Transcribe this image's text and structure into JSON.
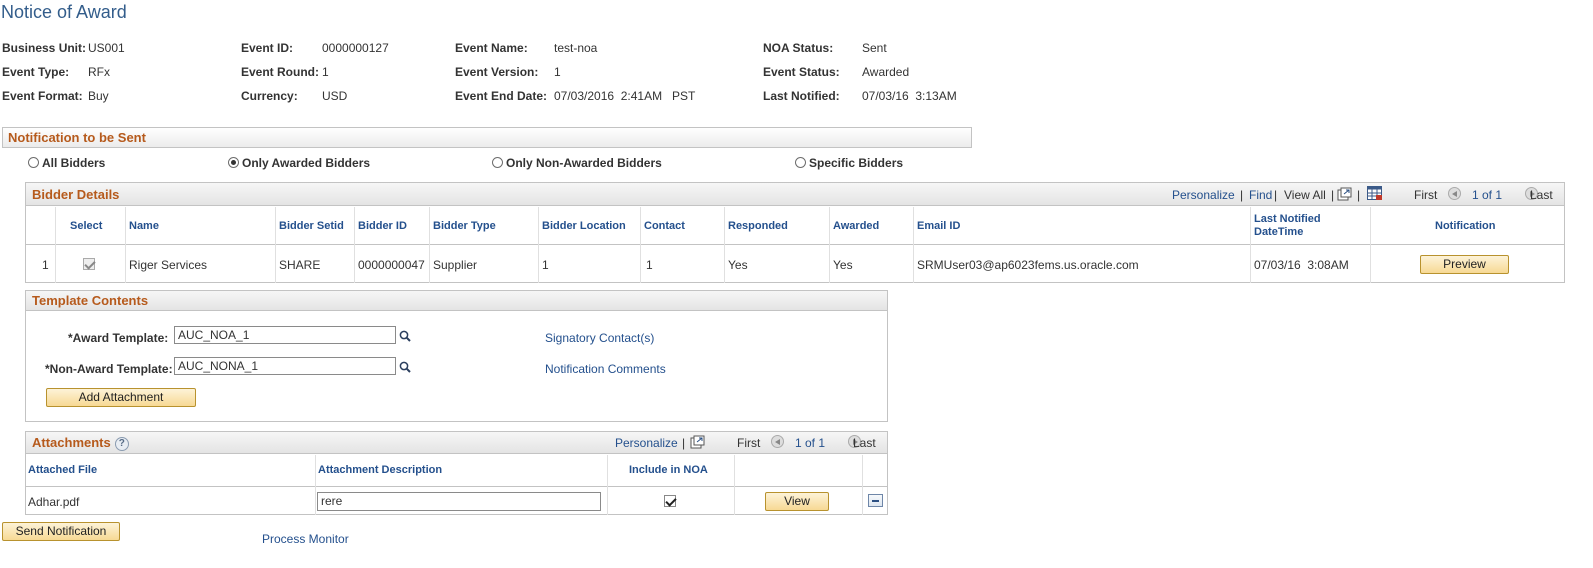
{
  "page": {
    "title": "Notice of Award"
  },
  "header": {
    "business_unit_label": "Business Unit:",
    "business_unit": "US001",
    "event_type_label": "Event Type:",
    "event_type": "RFx",
    "event_format_label": "Event Format:",
    "event_format": "Buy",
    "event_id_label": "Event ID:",
    "event_id": "0000000127",
    "event_round_label": "Event Round:",
    "event_round": "1",
    "currency_label": "Currency:",
    "currency": "USD",
    "event_name_label": "Event Name:",
    "event_name": "test-noa",
    "event_version_label": "Event Version:",
    "event_version": "1",
    "event_end_date_label": "Event End Date:",
    "event_end_date": "07/03/2016  2:41AM",
    "event_end_tz": "PST",
    "noa_status_label": "NOA Status:",
    "noa_status": "Sent",
    "event_status_label": "Event Status:",
    "event_status": "Awarded",
    "last_notified_label": "Last Notified:",
    "last_notified": "07/03/16  3:13AM"
  },
  "notification": {
    "section_title": "Notification to be Sent",
    "options": [
      "All Bidders",
      "Only Awarded Bidders",
      "Only Non-Awarded Bidders",
      "Specific Bidders"
    ],
    "selected": "Only Awarded Bidders"
  },
  "bidder_grid": {
    "title": "Bidder Details",
    "personalize": "Personalize",
    "find": "Find",
    "view_all": "View All",
    "sep": "|",
    "first": "First",
    "range": "1 of 1",
    "last": "Last",
    "columns": [
      "Select",
      "Name",
      "Bidder Setid",
      "Bidder ID",
      "Bidder Type",
      "Bidder Location",
      "Contact",
      "Responded",
      "Awarded",
      "Email ID",
      "Last Notified DateTime",
      "Notification"
    ],
    "last_notified_line1": "Last Notified",
    "last_notified_line2": "DateTime",
    "rows": [
      {
        "num": "1",
        "select": true,
        "name": "Riger Services",
        "setid": "SHARE",
        "bidder_id": "0000000047",
        "type": "Supplier",
        "location": "1",
        "contact": "1",
        "responded": "Yes",
        "awarded": "Yes",
        "email": "SRMUser03@ap6023fems.us.oracle.com",
        "last_notified": "07/03/16  3:08AM",
        "button": "Preview"
      }
    ]
  },
  "template": {
    "title": "Template Contents",
    "award_label": "*Award Template:",
    "award_value": "AUC_NOA_1",
    "nonaward_label": "*Non-Award Template:",
    "nonaward_value": "AUC_NONA_1",
    "signatory_link": "Signatory Contact(s)",
    "comments_link": "Notification Comments",
    "add_attachment": "Add Attachment"
  },
  "attachments": {
    "title": "Attachments",
    "help": "?",
    "personalize": "Personalize",
    "sep": "|",
    "first": "First",
    "range": "1 of 1",
    "last": "Last",
    "columns": [
      "Attached File",
      "Attachment Description",
      "Include in NOA"
    ],
    "rows": [
      {
        "file": "Adhar.pdf",
        "description": "rere",
        "include": true,
        "button": "View"
      }
    ]
  },
  "footer": {
    "send_button": "Send Notification",
    "process_monitor": "Process Monitor"
  },
  "colors": {
    "title": "#335d8b",
    "section": "#b65a1c",
    "link": "#24508d"
  }
}
